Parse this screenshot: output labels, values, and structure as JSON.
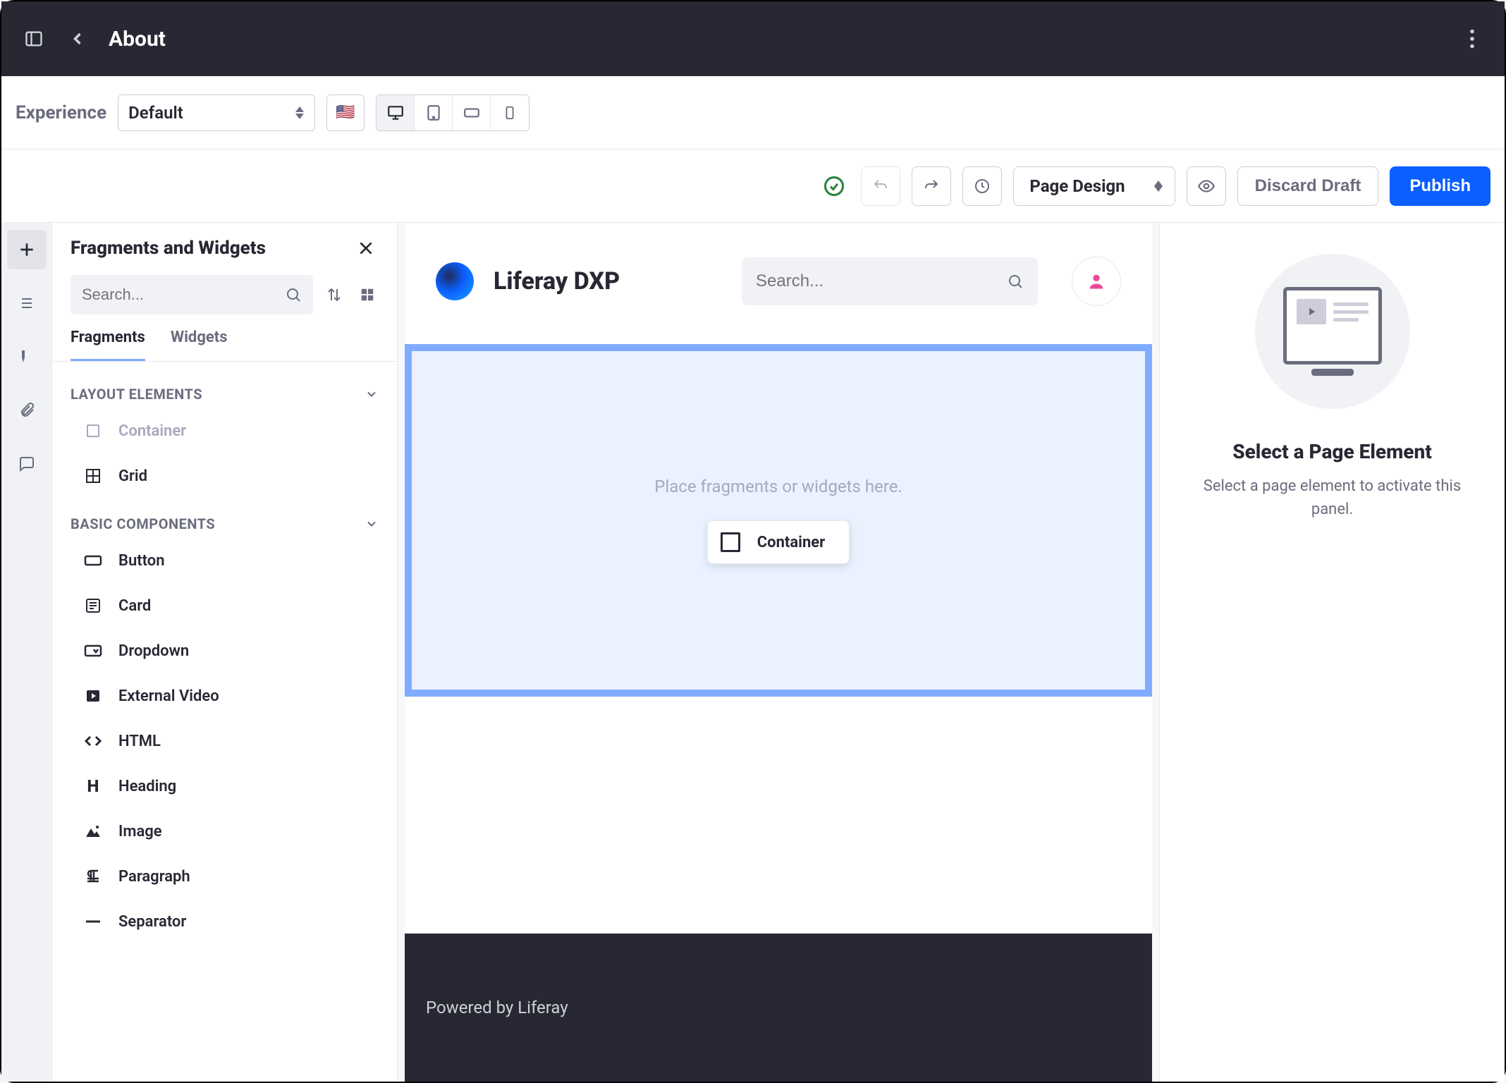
{
  "header": {
    "page_title": "About"
  },
  "experience_toolbar": {
    "label": "Experience",
    "selected": "Default",
    "locale_flag": "🇺🇸"
  },
  "action_toolbar": {
    "page_design": "Page Design",
    "discard_draft": "Discard Draft",
    "publish": "Publish"
  },
  "fragments_panel": {
    "title": "Fragments and Widgets",
    "search_placeholder": "Search...",
    "tabs": {
      "fragments": "Fragments",
      "widgets": "Widgets"
    },
    "sections": {
      "layout": {
        "title": "LAYOUT ELEMENTS",
        "items": [
          {
            "icon": "container-icon",
            "label": "Container",
            "dim": true
          },
          {
            "icon": "grid-icon",
            "label": "Grid",
            "dim": false
          }
        ]
      },
      "basic": {
        "title": "BASIC COMPONENTS",
        "items": [
          {
            "icon": "button-icon",
            "label": "Button"
          },
          {
            "icon": "card-icon",
            "label": "Card"
          },
          {
            "icon": "dropdown-icon",
            "label": "Dropdown"
          },
          {
            "icon": "video-icon",
            "label": "External Video"
          },
          {
            "icon": "code-icon",
            "label": "HTML"
          },
          {
            "icon": "heading-icon",
            "label": "Heading"
          },
          {
            "icon": "image-icon",
            "label": "Image"
          },
          {
            "icon": "paragraph-icon",
            "label": "Paragraph"
          },
          {
            "icon": "separator-icon",
            "label": "Separator"
          }
        ]
      }
    }
  },
  "canvas": {
    "brand": "Liferay DXP",
    "search_placeholder": "Search...",
    "dropzone_hint": "Place fragments or widgets here.",
    "chip_label": "Container",
    "footer": "Powered by Liferay"
  },
  "right_panel": {
    "title": "Select a Page Element",
    "subtitle": "Select a page element to activate this panel."
  }
}
